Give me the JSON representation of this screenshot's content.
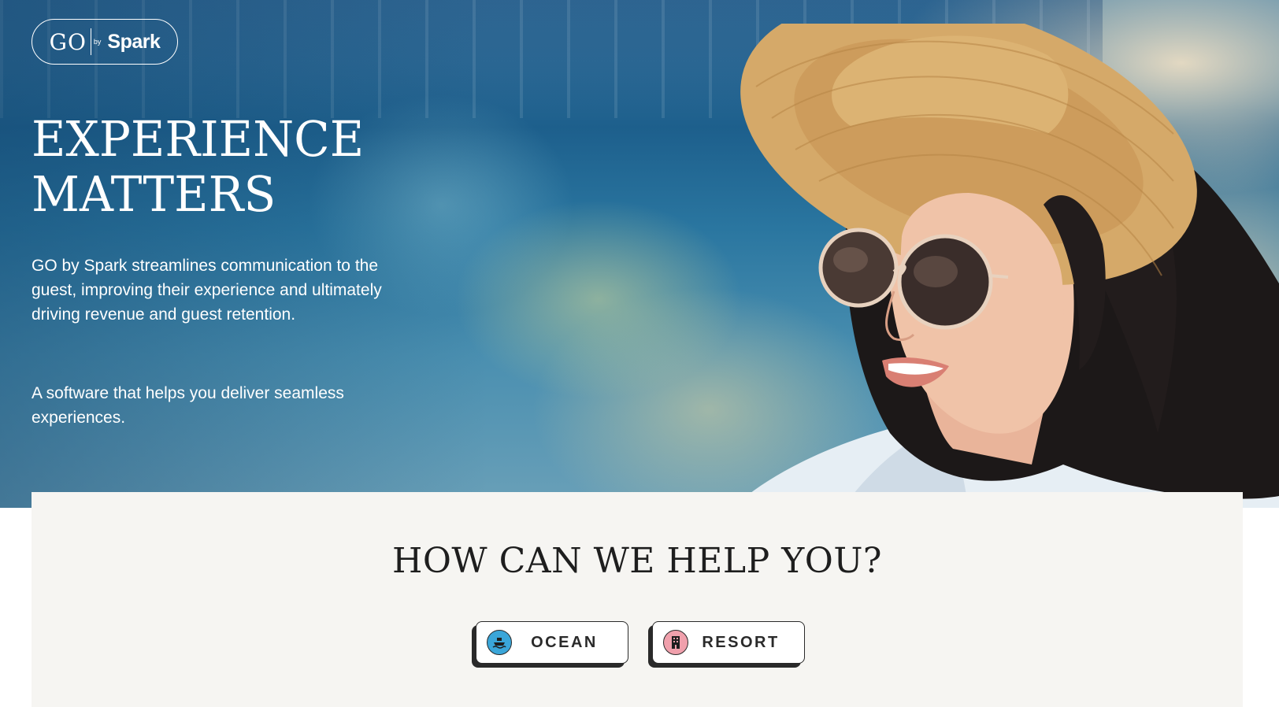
{
  "logo": {
    "go": "GO",
    "by": "by",
    "spark": "Spark"
  },
  "hero": {
    "headline_line1": "EXPERIENCE",
    "headline_line2": "MATTERS",
    "intro": "GO by Spark streamlines communication to the guest, improving their experience and ultimately driving revenue and guest retention.",
    "sub": "A software that helps you deliver seamless experiences."
  },
  "help": {
    "title": "HOW CAN WE HELP YOU?",
    "options": [
      {
        "label": "OCEAN",
        "icon": "ship-icon",
        "color": "#3aa6d9"
      },
      {
        "label": "RESORT",
        "icon": "building-icon",
        "color": "#f0a0ac"
      }
    ]
  },
  "colors": {
    "panel_bg": "#f6f5f2",
    "ink": "#2a2a2a",
    "hero_blue": "#1d5f8c"
  }
}
